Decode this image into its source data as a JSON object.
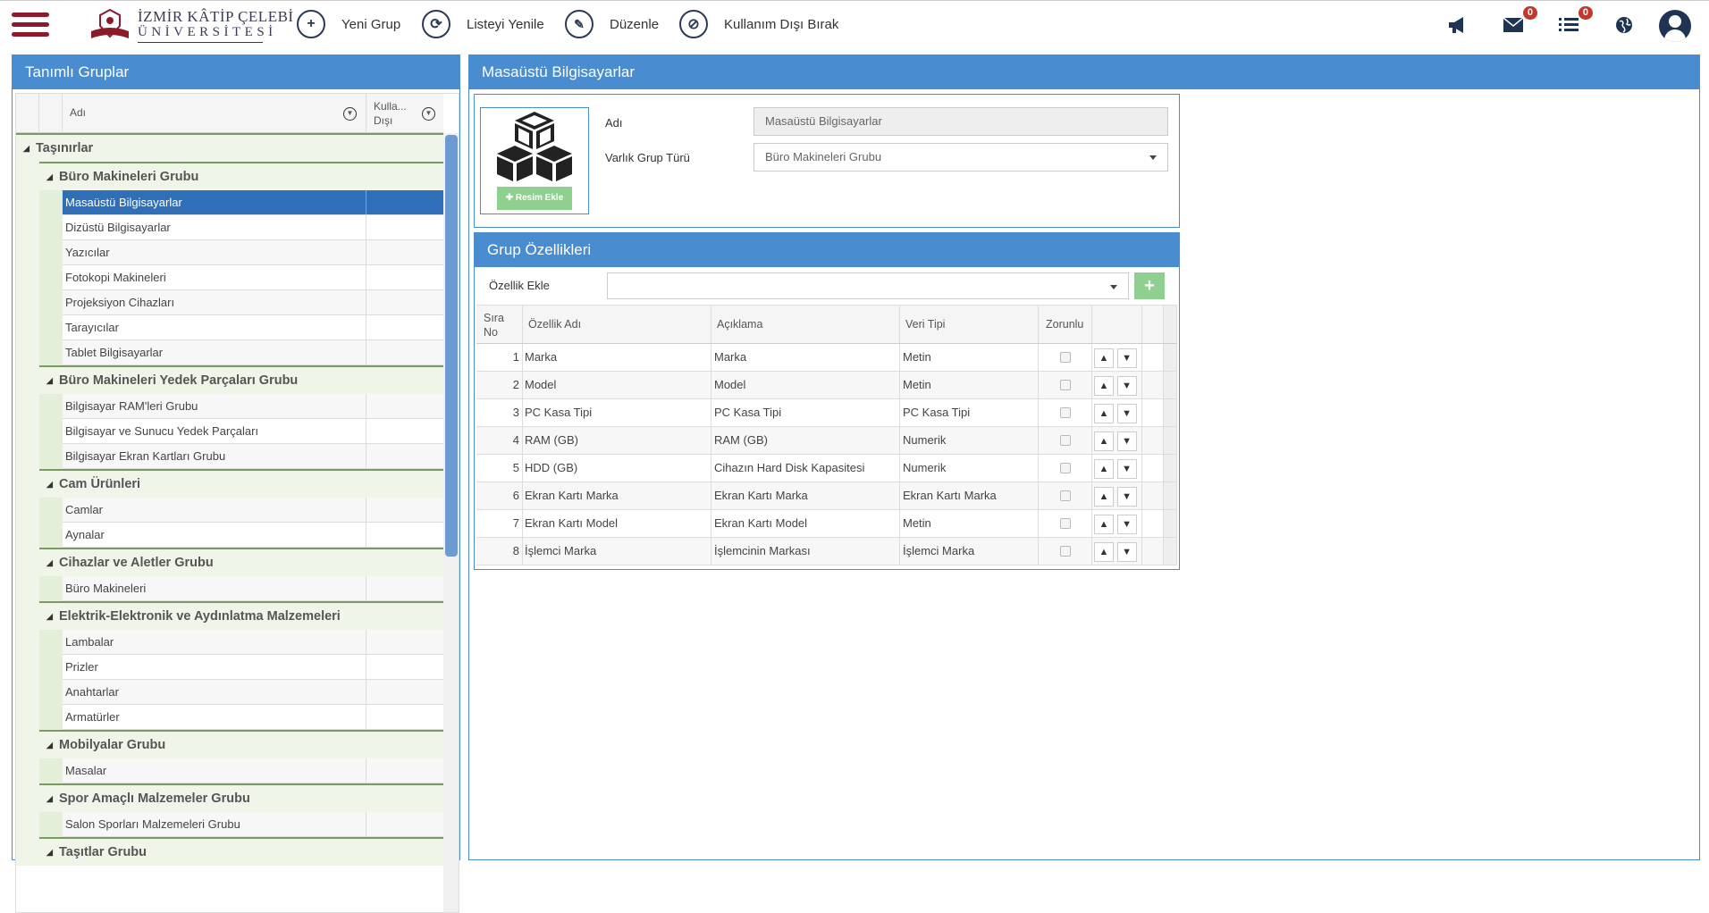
{
  "header": {
    "logo": {
      "line1": "İZMİR KÂTİP ÇELEBİ",
      "line2": "ÜNİVERSİTESİ"
    },
    "toolbar": [
      {
        "icon": "plus-icon",
        "glyph": "+",
        "label": "Yeni Grup"
      },
      {
        "icon": "refresh-icon",
        "glyph": "⟳",
        "label": "Listeyi Yenile"
      },
      {
        "icon": "pencil-icon",
        "glyph": "✎",
        "label": "Düzenle"
      },
      {
        "icon": "ban-icon",
        "glyph": "⊘",
        "label": "Kullanım Dışı Bırak"
      }
    ],
    "icons": {
      "announcements": "megaphone-icon",
      "messages_badge": "0",
      "tasks_badge": "0",
      "globe": "globe-icon",
      "user": "user-icon"
    }
  },
  "left_panel": {
    "title": "Tanımlı Gruplar",
    "columns": {
      "name": "Adı",
      "disabled": "Kulla... Dışı"
    },
    "tree": {
      "root": "Taşınırlar",
      "groups": [
        {
          "name": "Büro Makineleri Grubu",
          "items": [
            "Masaüstü Bilgisayarlar",
            "Dizüstü Bilgisayarlar",
            "Yazıcılar",
            "Fotokopi Makineleri",
            "Projeksiyon Cihazları",
            "Tarayıcılar",
            "Tablet Bilgisayarlar"
          ]
        },
        {
          "name": "Büro Makineleri Yedek Parçaları Grubu",
          "items": [
            "Bilgisayar RAM'leri Grubu",
            "Bilgisayar ve Sunucu Yedek Parçaları",
            "Bilgisayar Ekran Kartları Grubu"
          ]
        },
        {
          "name": "Cam Ürünleri",
          "items": [
            "Camlar",
            "Aynalar"
          ]
        },
        {
          "name": "Cihazlar ve Aletler Grubu",
          "items": [
            "Büro Makineleri"
          ]
        },
        {
          "name": "Elektrik-Elektronik ve Aydınlatma Malzemeleri",
          "items": [
            "Lambalar",
            "Prizler",
            "Anahtarlar",
            "Armatürler"
          ]
        },
        {
          "name": "Mobilyalar Grubu",
          "items": [
            "Masalar"
          ]
        },
        {
          "name": "Spor Amaçlı Malzemeler Grubu",
          "items": [
            "Salon Sporları Malzemeleri Grubu"
          ]
        },
        {
          "name": "Taşıtlar Grubu",
          "items": []
        }
      ],
      "selected": "Masaüstü Bilgisayarlar"
    }
  },
  "right_panel": {
    "title": "Masaüstü Bilgisayarlar",
    "add_image_label": "Resim Ekle",
    "name_label": "Adı",
    "name_value": "Masaüstü Bilgisayarlar",
    "type_label": "Varlık Grup Türü",
    "type_value": "Büro Makineleri Grubu",
    "properties": {
      "title": "Grup Özellikleri",
      "add_label": "Özellik Ekle",
      "columns": {
        "no": "Sıra No",
        "name": "Özellik Adı",
        "desc": "Açıklama",
        "type": "Veri Tipi",
        "required": "Zorunlu"
      },
      "rows": [
        {
          "no": "1",
          "name": "Marka",
          "desc": "Marka",
          "type": "Metin"
        },
        {
          "no": "2",
          "name": "Model",
          "desc": "Model",
          "type": "Metin"
        },
        {
          "no": "3",
          "name": "PC Kasa Tipi",
          "desc": "PC Kasa Tipi",
          "type": "PC Kasa Tipi"
        },
        {
          "no": "4",
          "name": "RAM (GB)",
          "desc": "RAM (GB)",
          "type": "Numerik"
        },
        {
          "no": "5",
          "name": "HDD (GB)",
          "desc": "Cihazın Hard Disk Kapasitesi",
          "type": "Numerik"
        },
        {
          "no": "6",
          "name": "Ekran Kartı Marka",
          "desc": "Ekran Kartı Marka",
          "type": "Ekran Kartı Marka"
        },
        {
          "no": "7",
          "name": "Ekran Kartı Model",
          "desc": "Ekran Kartı Model",
          "type": "Metin"
        },
        {
          "no": "8",
          "name": "İşlemci Marka",
          "desc": "İşlemcinin Markası",
          "type": "İşlemci Marka"
        }
      ]
    }
  }
}
